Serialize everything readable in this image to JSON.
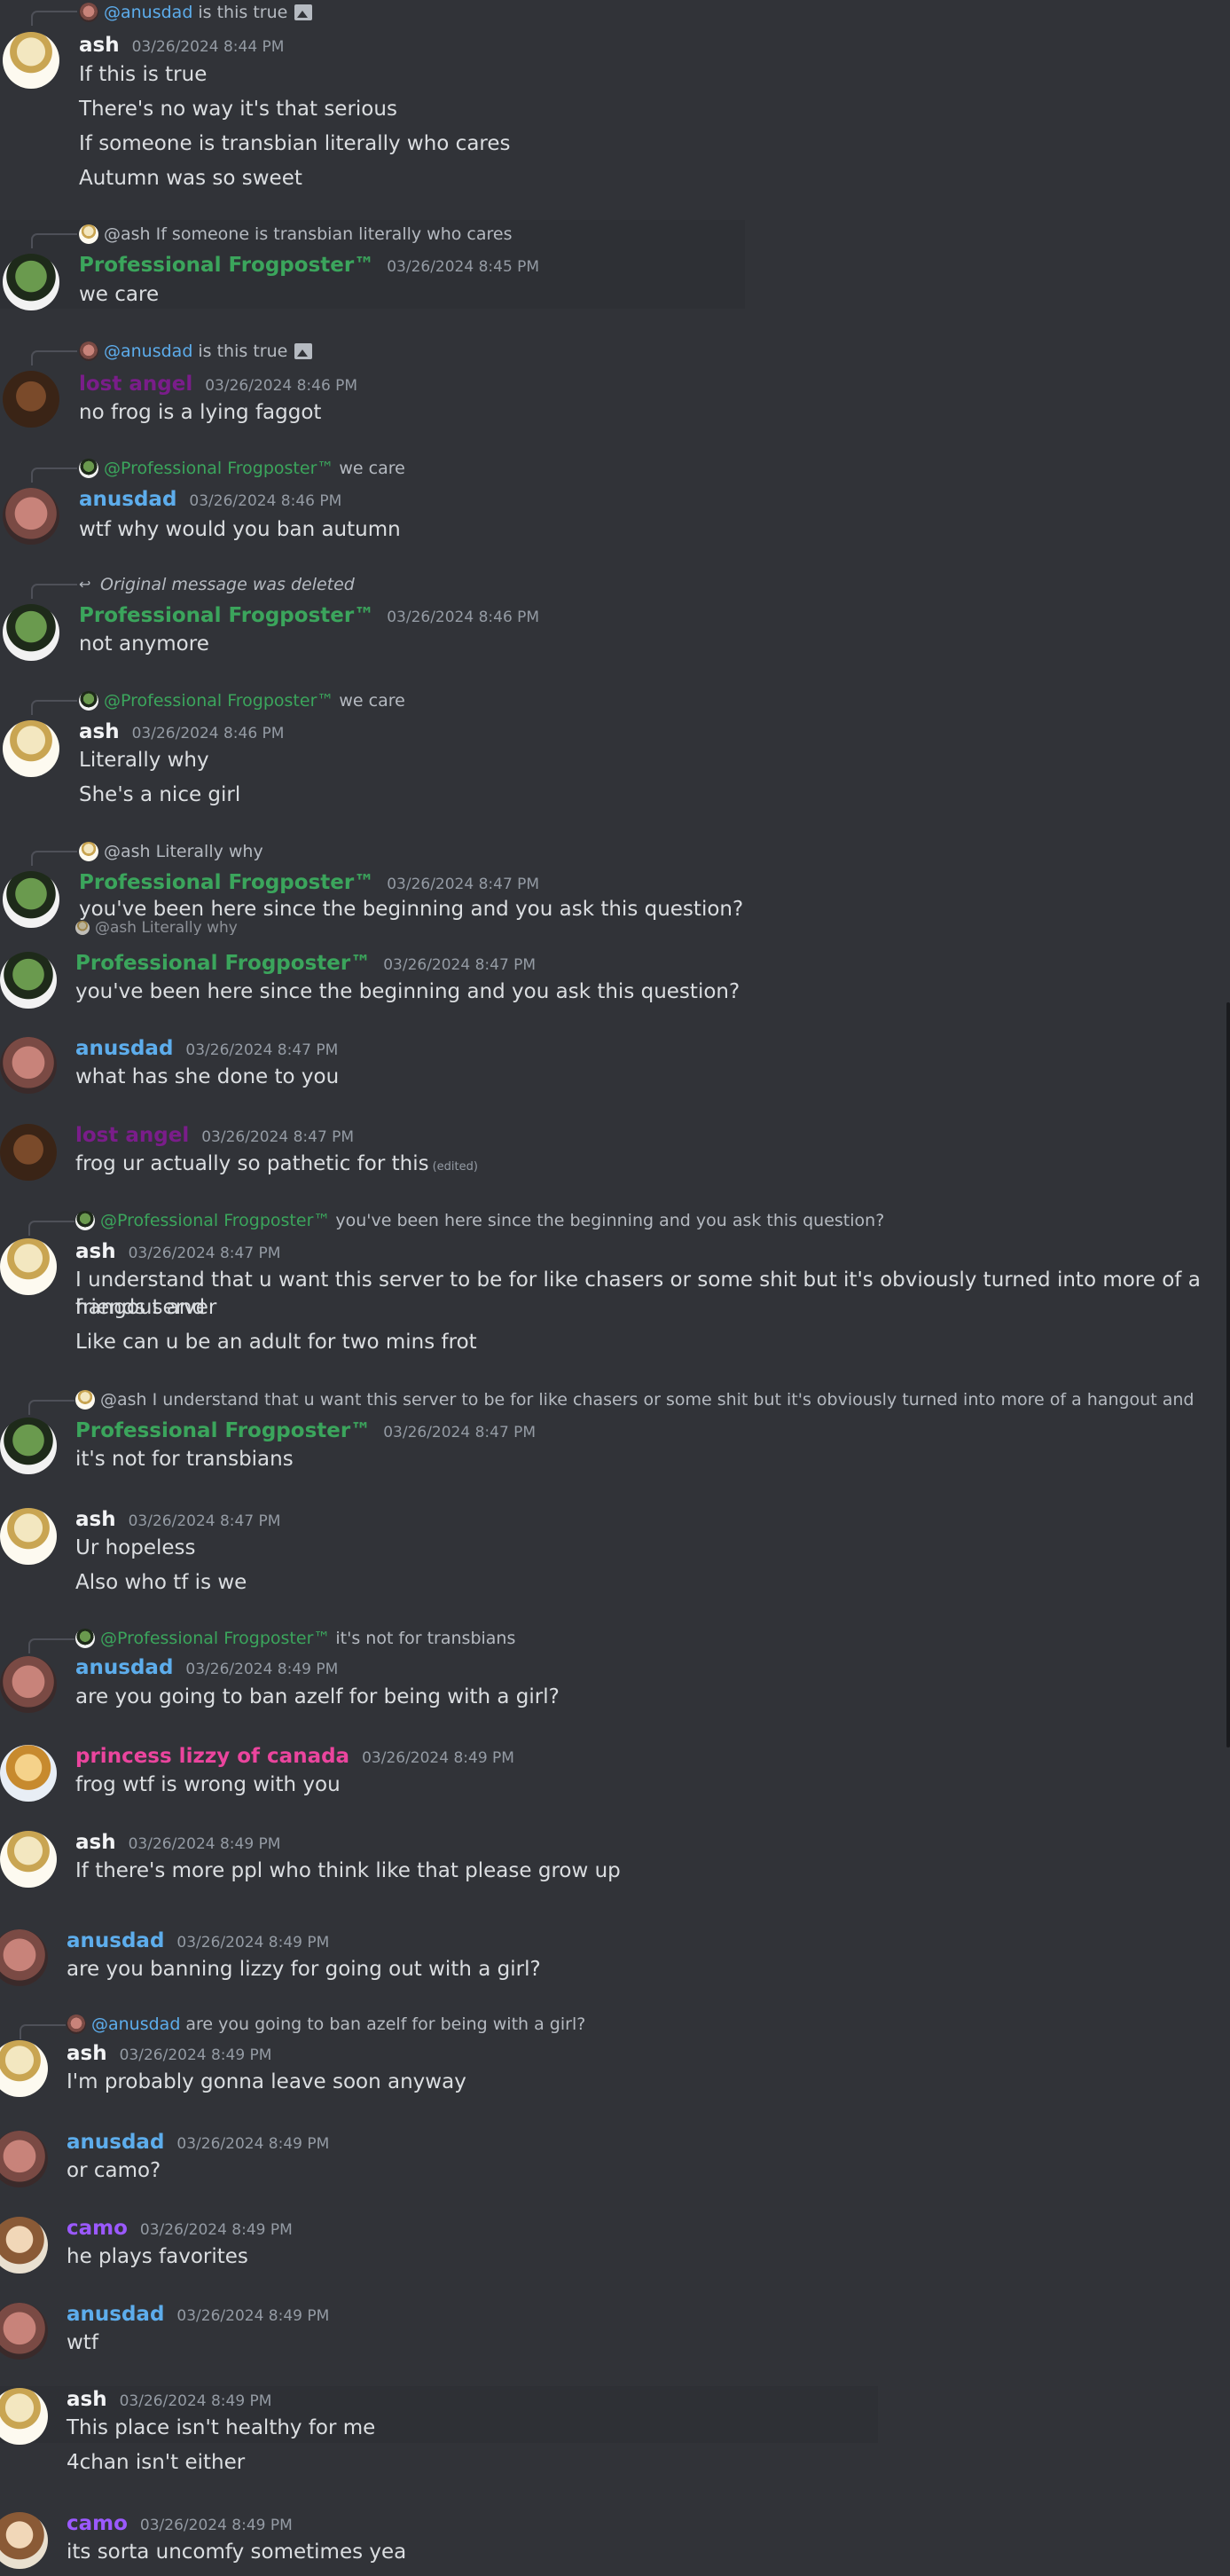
{
  "users": {
    "ash": "ash",
    "frog": "Professional Frogposter™",
    "anusdad": "anusdad",
    "lost": "lost angel",
    "liz": "princess lizzy of canada",
    "camo": "camo"
  },
  "mentions": {
    "anusdad": "@anusdad",
    "frog": "@Professional Frogposter™",
    "ash": "@ash"
  },
  "replies": {
    "r1": "is this true",
    "r2": "If someone is transbian literally who cares",
    "r3": "is this true",
    "r4": "we care",
    "r5": "Original message was deleted",
    "r6": "we care",
    "r7": "Literally why",
    "r7b": "@ash Literally why",
    "r8": "you've been here since the beginning and you ask this question?",
    "r9": "I understand that u want this server to be for like chasers or some shit but it's obviously turned into more of a hangout and friends se",
    "r10": "it's not for transbians",
    "r11": "are you going to ban azelf for being with a girl?"
  },
  "ts": {
    "t844": "03/26/2024 8:44 PM",
    "t845": "03/26/2024 8:45 PM",
    "t846": "03/26/2024 8:46 PM",
    "t847": "03/26/2024 8:47 PM",
    "t849": "03/26/2024 8:49 PM"
  },
  "messages": {
    "m1": [
      "If this is true",
      "There's no way it's that serious",
      "If someone is transbian literally who cares",
      "Autumn was so sweet"
    ],
    "m2": [
      "we care"
    ],
    "m3": [
      "no frog is a lying faggot"
    ],
    "m4": [
      "wtf why would you ban autumn"
    ],
    "m5": [
      "not anymore"
    ],
    "m6": [
      "Literally why",
      "She's a nice girl"
    ],
    "m7": [
      "you've been here since the beginning and you ask this question?"
    ],
    "m8": [
      "you've been here since the beginning and you ask this question?"
    ],
    "m9": [
      "what has she done to you"
    ],
    "m10": [
      "frog ur actually so pathetic for this"
    ],
    "m10_edited": "(edited)",
    "m11": [
      "I understand that u want this server to be for like chasers or some shit but it's obviously turned into more of a hangout and",
      "friends server",
      "Like can u be an adult for two mins frot"
    ],
    "m12": [
      "it's not for transbians"
    ],
    "m13": [
      "Ur hopeless",
      "Also who tf is we"
    ],
    "m14": [
      "are you going to ban azelf for being with a girl?"
    ],
    "m15": [
      "frog wtf is wrong with you"
    ],
    "m16": [
      "If there's more ppl who think like that please grow up"
    ],
    "m17": [
      "are you banning lizzy for going out with a girl?"
    ],
    "m18": [
      "I'm probably gonna leave soon anyway"
    ],
    "m19": [
      "or camo?"
    ],
    "m20": [
      "he plays favorites"
    ],
    "m21": [
      "wtf"
    ],
    "m22": [
      "This place isn't healthy for me",
      "4chan isn't either"
    ],
    "m23": [
      "its sorta uncomfy sometimes yea"
    ]
  },
  "colors": {
    "background": "#313338",
    "ash": "#f2f3f5",
    "frog": "#3ba55c",
    "anusdad": "#5dadec",
    "liz": "#eb459e",
    "camo": "#9b59ff",
    "lost": "#7a1d8a"
  }
}
